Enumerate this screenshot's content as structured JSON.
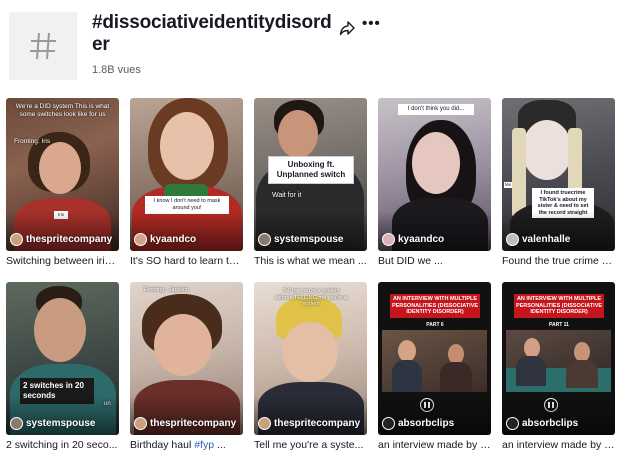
{
  "header": {
    "title": "#dissociativeidentitydisorder",
    "views": "1.8B vues",
    "icons": {
      "tag": "hashtag-icon",
      "share": "share-icon",
      "more": "more-options-icon"
    }
  },
  "videos": [
    {
      "username": "thespritecompany",
      "caption": "Switching between iris ...",
      "overlay_text": "We're a DID system This is what some switches look like for us",
      "overlay_label": "Fronting: Iris",
      "badge_text": "Iris"
    },
    {
      "username": "kyaandco",
      "caption": "It's SO hard to learn to ...",
      "overlay_text": "I know I don't need to mask around you!"
    },
    {
      "username": "systemspouse",
      "caption": "This is what we mean ...",
      "overlay_text": "Unboxing ft. Unplanned switch",
      "overlay_sub": "Wait for it"
    },
    {
      "username": "kyaandco",
      "caption": "But DID we ...",
      "overlay_text": "I don't think you did..."
    },
    {
      "username": "valenhalle",
      "caption": "Found the true crime Ti...",
      "overlay_text": "I found truecrime TikTok's about my sister & need to set the record straight",
      "overlay_side": "Me"
    },
    {
      "username": "systemspouse",
      "caption": "2 switching in 20 seco...",
      "overlay_text": "2 switches in 20 seconds",
      "overlay_side": "un"
    },
    {
      "username": "thespritecompany",
      "caption_prefix": "Birthday haul ",
      "caption_hashtag": "#fyp",
      "caption_suffix": " ...",
      "overlay_label": "Fronting : Jackson"
    },
    {
      "username": "thespritecompany",
      "caption": "Tell me you're a syste...",
      "overlay_text": "Tell me you're a system without TELLING me you're a system"
    },
    {
      "username": "absorbclips",
      "caption": "an interview made by a...",
      "overlay_text": "AN INTERVIEW WITH MULTIPLE PERSONALITIES (DISSOCIATIVE IDENTITY DISORDER)",
      "part": "PART 6"
    },
    {
      "username": "absorbclips",
      "caption": "an interview made by a...",
      "overlay_text": "AN INTERVIEW WITH MULTIPLE PERSONALITIES (DISSOCIATIVE IDENTITY DISORDER)",
      "part": "PART 11"
    }
  ],
  "colors": {
    "link": "#2b5db9",
    "text": "#161823",
    "muted": "#5b5b60",
    "banner": "#c4161c"
  }
}
